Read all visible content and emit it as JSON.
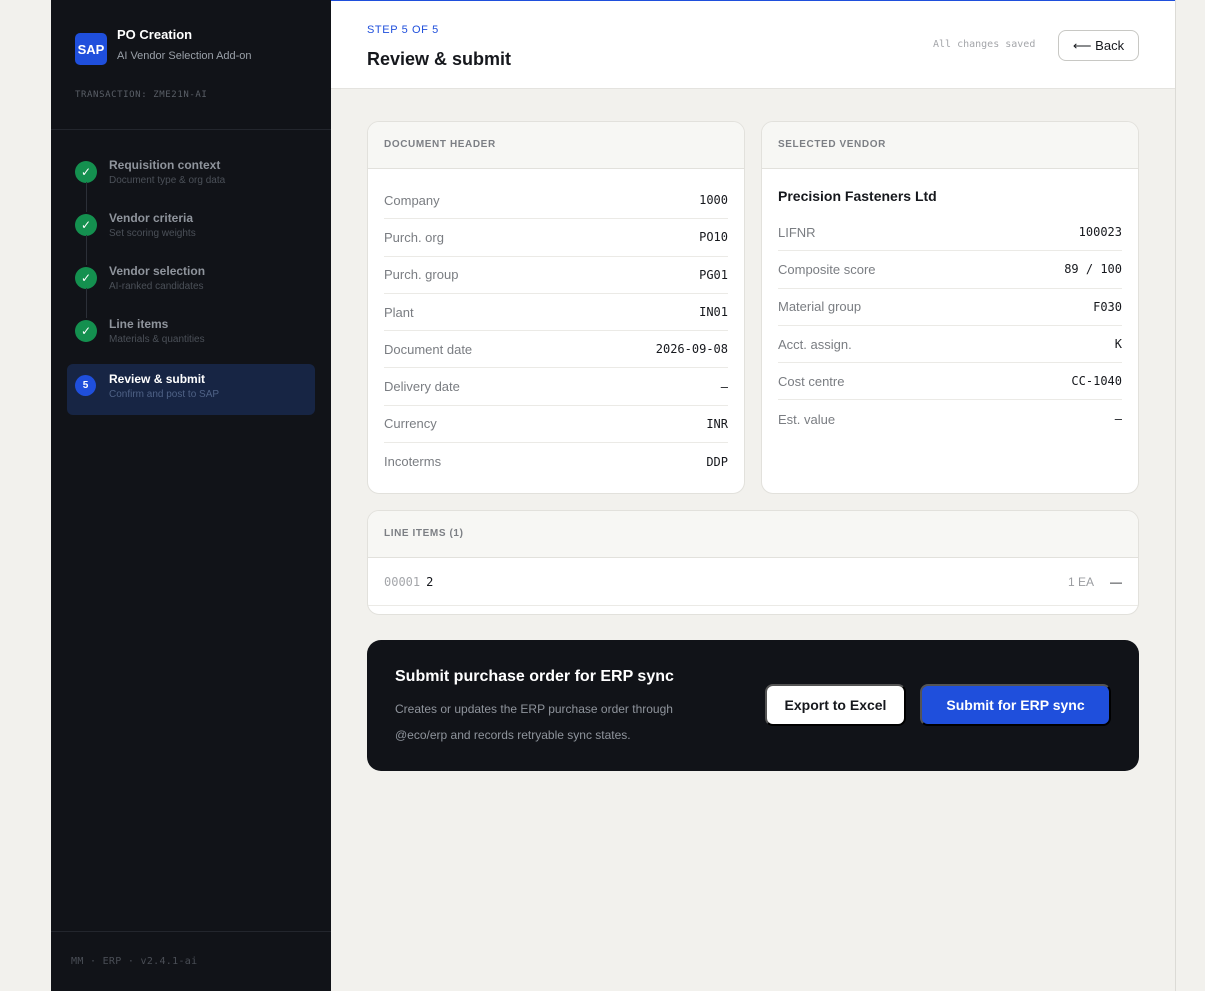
{
  "brand": {
    "logo_text": "SAP",
    "title": "PO Creation",
    "subtitle": "AI Vendor Selection Add-on",
    "transaction": "TRANSACTION: ZME21N-AI"
  },
  "steps": [
    {
      "marker": "✓",
      "title": "Requisition context",
      "subtitle": "Document type & org data",
      "state": "done"
    },
    {
      "marker": "✓",
      "title": "Vendor criteria",
      "subtitle": "Set scoring weights",
      "state": "done"
    },
    {
      "marker": "✓",
      "title": "Vendor selection",
      "subtitle": "AI-ranked candidates",
      "state": "done"
    },
    {
      "marker": "✓",
      "title": "Line items",
      "subtitle": "Materials & quantities",
      "state": "done"
    },
    {
      "marker": "5",
      "title": "Review & submit",
      "subtitle": "Confirm and post to SAP",
      "state": "active"
    }
  ],
  "sidebar_footer": "MM · ERP · v2.4.1-ai",
  "header": {
    "step_label": "STEP 5 OF 5",
    "title": "Review & submit",
    "saved_status": "All changes saved",
    "back_label": "⟵ Back"
  },
  "document_header": {
    "heading": "DOCUMENT HEADER",
    "rows": [
      {
        "key": "Company",
        "value": "1000"
      },
      {
        "key": "Purch. org",
        "value": "PO10"
      },
      {
        "key": "Purch. group",
        "value": "PG01"
      },
      {
        "key": "Plant",
        "value": "IN01"
      },
      {
        "key": "Document date",
        "value": "2026-09-08"
      },
      {
        "key": "Delivery date",
        "value": "—"
      },
      {
        "key": "Currency",
        "value": "INR"
      },
      {
        "key": "Incoterms",
        "value": "DDP"
      }
    ]
  },
  "vendor": {
    "heading": "SELECTED VENDOR",
    "name": "Precision Fasteners Ltd",
    "rows": [
      {
        "key": "LIFNR",
        "value": "100023"
      },
      {
        "key": "Composite score",
        "value": "89 / 100"
      },
      {
        "key": "Material group",
        "value": "F030"
      },
      {
        "key": "Acct. assign.",
        "value": "K"
      },
      {
        "key": "Cost centre",
        "value": "CC-1040"
      },
      {
        "key": "Est. value",
        "value": "—"
      }
    ]
  },
  "line_items": {
    "heading": "LINE ITEMS (1)",
    "items": [
      {
        "number": "00001",
        "material": "2",
        "quantity": "1 EA",
        "price": "—"
      }
    ]
  },
  "submit": {
    "title": "Submit purchase order for ERP sync",
    "description": "Creates or updates the ERP purchase order through @eco/erp and records retryable sync states.",
    "export_label": "Export to Excel",
    "submit_label": "Submit for ERP sync"
  },
  "colors": {
    "accent": "#1f4fdc",
    "sidebar_bg": "#111318",
    "done": "#14904f",
    "page_bg": "#f2f1ed"
  }
}
